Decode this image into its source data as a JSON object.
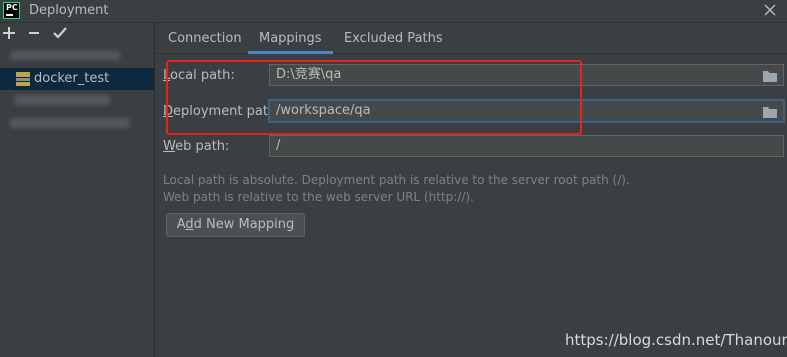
{
  "window": {
    "title": "Deployment",
    "app_logo_text": "PC"
  },
  "sidebar": {
    "toolbar": {
      "add": "+",
      "remove": "−",
      "confirm": "✔"
    },
    "servers": [
      {
        "label": "docker_test",
        "icon": "sftp-icon",
        "selected": true
      }
    ]
  },
  "tabs": [
    {
      "label": "Connection",
      "active": false
    },
    {
      "label": "Mappings",
      "active": true
    },
    {
      "label": "Excluded Paths",
      "active": false
    }
  ],
  "mappings": {
    "local_path": {
      "label_mnemonic": "L",
      "label_rest": "ocal path:",
      "value": "D:\\竞赛\\qa"
    },
    "deployment_path": {
      "label_mnemonic": "D",
      "label_rest": "eployment path:",
      "value": "/workspace/qa"
    },
    "web_path": {
      "label_mnemonic": "W",
      "label_rest": "eb path:",
      "value": "/"
    }
  },
  "hints": [
    "Local path is absolute. Deployment path is relative to the server root path (/).",
    "Web path is relative to the web server URL (http://)."
  ],
  "add_mapping_button": {
    "prefix": "A",
    "mnemonic": "d",
    "rest": "d New Mapping"
  },
  "watermark": "https://blog.csdn.net/Thanours",
  "colors": {
    "background": "#3c3f41",
    "input_background": "#45494a",
    "selection": "#0d293e",
    "tab_indicator": "#4a88c7",
    "focus_border": "#3d6185",
    "highlight_box": "#e8231d"
  }
}
